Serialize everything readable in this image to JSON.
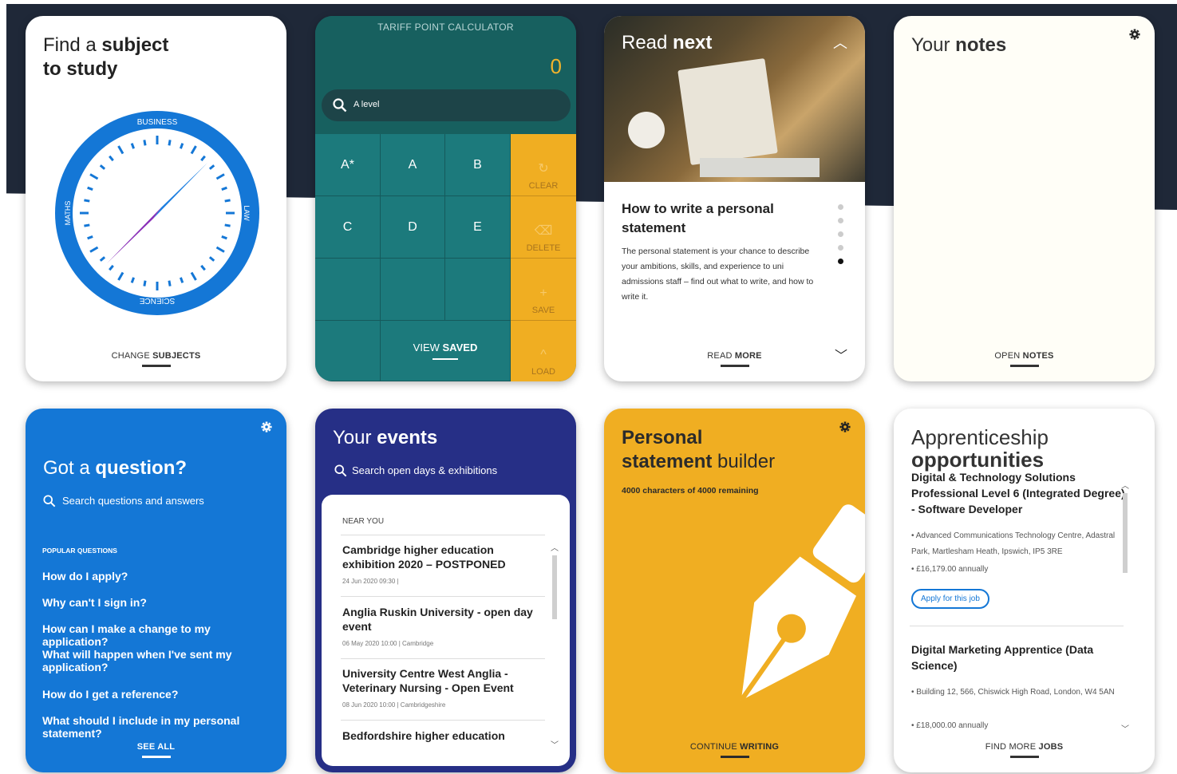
{
  "subject": {
    "title_light": "Find a",
    "title_bold": "subject",
    "title_line2": "to study",
    "compass_labels": {
      "top": "BUSINESS",
      "left": "MATHS",
      "right": "LAW",
      "bottom": "SCIENCE"
    },
    "footer_light": "CHANGE",
    "footer_bold": "SUBJECTS"
  },
  "calculator": {
    "header": "TARIFF POINT CALCULATOR",
    "points": "0",
    "search_value": "A level",
    "grades": [
      "A*",
      "A",
      "B",
      "C",
      "D",
      "E"
    ],
    "actions": [
      "CLEAR",
      "DELETE",
      "SAVE",
      "LOAD"
    ],
    "view_light": "VIEW",
    "view_bold": "SAVED"
  },
  "read_next": {
    "title_light": "Read",
    "title_bold": "next",
    "article_title": "How to write a personal statement",
    "article_body": "The personal statement is your chance to describe your ambitions, skills, and experience to uni admissions staff – find out what to write, and how to write it.",
    "footer_light": "READ",
    "footer_bold": "MORE"
  },
  "notes": {
    "title_light": "Your",
    "title_bold": "notes",
    "footer_light": "OPEN",
    "footer_bold": "NOTES"
  },
  "question": {
    "title_light": "Got a",
    "title_bold": "question?",
    "search_placeholder": "Search questions and answers",
    "section_label": "POPULAR QUESTIONS",
    "questions": [
      "How do I apply?",
      "Why can't I sign in?",
      "How can I make a change to my application?",
      "What will happen when I've sent my application?",
      "How do I get a reference?",
      "What should I include in my personal statement?"
    ],
    "footer": "SEE ALL"
  },
  "events": {
    "title_light": "Your",
    "title_bold": "events",
    "search_placeholder": "Search open days & exhibitions",
    "section_label": "NEAR YOU",
    "items": [
      {
        "title": "Cambridge higher education exhibition 2020 – POSTPONED",
        "meta": "24 Jun 2020 09:30 |"
      },
      {
        "title": "Anglia Ruskin University - open day event",
        "meta": "06 May 2020 10:00 | Cambridge"
      },
      {
        "title": "University Centre West Anglia - Veterinary Nursing - Open Event",
        "meta": "08 Jun 2020 10:00 | Cambridgeshire"
      },
      {
        "title": "Bedfordshire higher education",
        "meta": ""
      }
    ]
  },
  "statement": {
    "title_bold1": "Personal",
    "title_bold2": "statement",
    "title_light": "builder",
    "chars_info": "4000 characters of 4000 remaining",
    "footer_light": "CONTINUE",
    "footer_bold": "WRITING"
  },
  "apprenticeship": {
    "title_light": "Apprenticeship",
    "title_bold": "opportunities",
    "jobs": [
      {
        "title": "Digital & Technology Solutions Professional Level 6 (Integrated Degree) - Software Developer",
        "location": "Advanced Communications Technology Centre, Adastral Park, Martlesham Heath, Ipswich, IP5 3RE",
        "salary": "£16,179.00 annually"
      },
      {
        "title": "Digital Marketing Apprentice (Data Science)",
        "location": "Building 12, 566, Chiswick High Road, London, W4 5AN",
        "salary": "£18,000.00 annually"
      }
    ],
    "apply_label": "Apply for this job",
    "footer_light": "FIND MORE",
    "footer_bold": "JOBS"
  },
  "colors": {
    "teal": "#1c6e72",
    "gold": "#f0ae22",
    "blue": "#1477d6",
    "navy": "#262f86",
    "dark": "#1f2838"
  }
}
